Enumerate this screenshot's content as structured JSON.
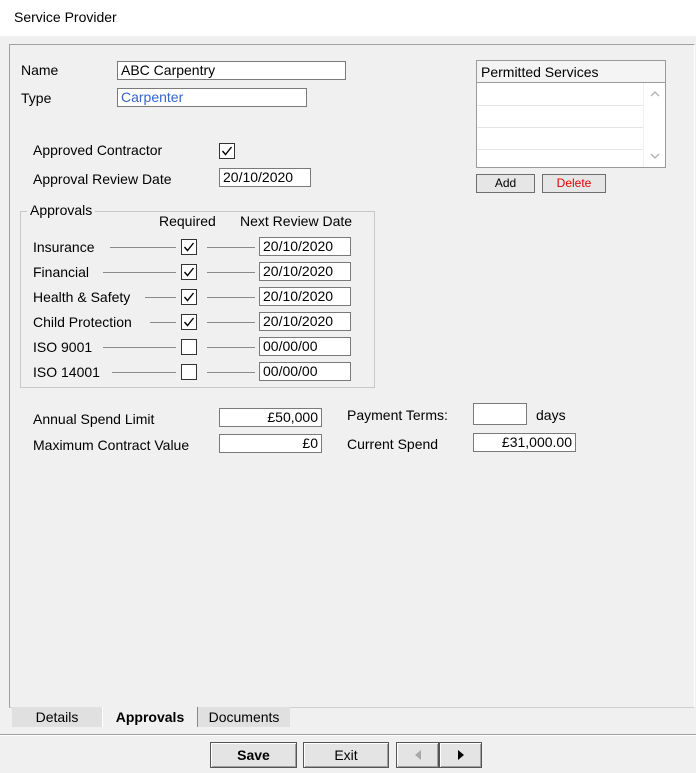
{
  "window": {
    "title": "Service Provider"
  },
  "details": {
    "name_label": "Name",
    "name_value": "ABC Carpentry",
    "type_label": "Type",
    "type_value": "Carpenter"
  },
  "permitted_services": {
    "header": "Permitted Services",
    "add_label": "Add",
    "delete_label": "Delete",
    "delete_color": "#e00000"
  },
  "approval": {
    "approved_label": "Approved Contractor",
    "approved_checked": true,
    "review_label": "Approval Review Date",
    "review_value": "20/10/2020"
  },
  "approvals_group": {
    "legend": "Approvals",
    "col_required": "Required",
    "col_next_review": "Next Review Date",
    "rows": [
      {
        "label": "Insurance",
        "required": true,
        "date": "20/10/2020"
      },
      {
        "label": "Financial",
        "required": true,
        "date": "20/10/2020"
      },
      {
        "label": "Health & Safety",
        "required": true,
        "date": "20/10/2020"
      },
      {
        "label": "Child Protection",
        "required": true,
        "date": "20/10/2020"
      },
      {
        "label": "ISO 9001",
        "required": false,
        "date": "00/00/00"
      },
      {
        "label": "ISO 14001",
        "required": false,
        "date": "00/00/00"
      }
    ]
  },
  "finance": {
    "annual_label": "Annual Spend Limit",
    "annual_value": "£50,000",
    "max_label": "Maximum Contract Value",
    "max_value": "£0",
    "terms_label": "Payment Terms:",
    "terms_value": "",
    "days_label": "days",
    "current_label": "Current Spend",
    "current_value": "£31,000.00"
  },
  "tabs": [
    {
      "label": "Details",
      "active": false
    },
    {
      "label": "Approvals",
      "active": true
    },
    {
      "label": "Documents",
      "active": false
    }
  ],
  "footer": {
    "save_label": "Save",
    "exit_label": "Exit",
    "prev_icon": "triangle-left-icon",
    "next_icon": "triangle-right-icon"
  }
}
